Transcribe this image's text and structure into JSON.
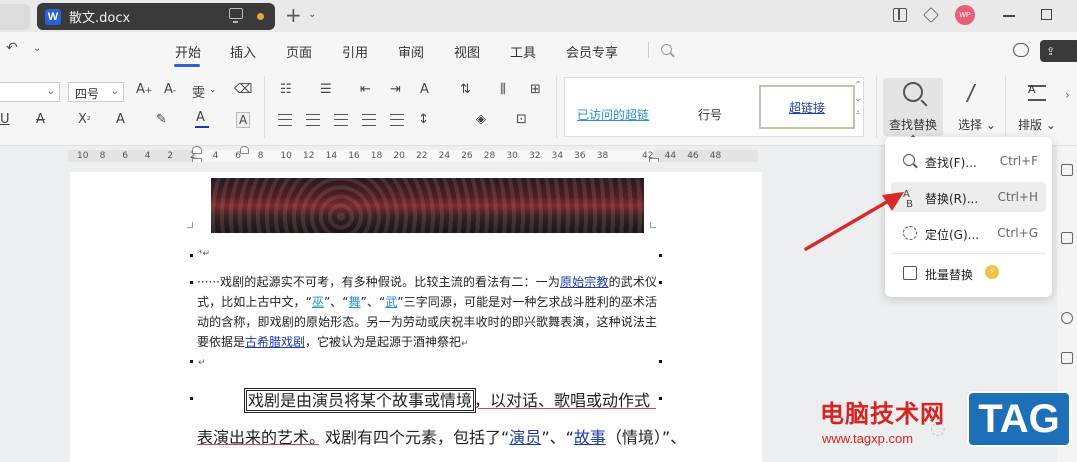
{
  "tabs": {
    "document_title": "散文.docx",
    "app_letter": "W",
    "new_tab_icon": "plus-icon",
    "avatar_text": "WP"
  },
  "menu": {
    "items": [
      "开始",
      "插入",
      "页面",
      "引用",
      "审阅",
      "视图",
      "工具",
      "会员专享"
    ],
    "active": "开始"
  },
  "ribbon": {
    "font_size": "四号",
    "styles": {
      "visited_link": "已访问的超链",
      "line_number": "行号",
      "hyperlink": "超链接"
    },
    "find_replace_label": "查找替换",
    "select_label": "选择",
    "layout_label": "排版"
  },
  "ruler": {
    "numbers": [
      "10",
      "8",
      "6",
      "4",
      "2",
      "2",
      "4",
      "6",
      "8",
      "10",
      "12",
      "14",
      "16",
      "18",
      "20",
      "22",
      "24",
      "26",
      "28",
      "30",
      "32",
      "34",
      "36",
      "38",
      "42",
      "44",
      "46",
      "48"
    ]
  },
  "document": {
    "para1": {
      "lead": "······戏剧的起源实不可考，有多种假说。比较主流的看法有二：一为",
      "link1": "原始宗教",
      "t1": "的武术仪式，比如上古中文，“",
      "link2": "巫",
      "t2": "”、“",
      "link3": "舞",
      "t3": "”、“",
      "link4": "武",
      "t4": "”三字同源，可能是对一种乞求战斗胜利的巫术活动的含称，即戏剧的原始形态。另一为劳动或庆祝丰收时的即兴歌舞表演，这种说法主要依据是",
      "link5": "古希腊戏剧",
      "t5": "，它被认为是起源于酒神祭祀"
    },
    "line1": {
      "boxed": "戏剧是由演员将某个故事或情境",
      "rest": "，以对话、歌唱或动作式"
    },
    "line2": {
      "t1": "表演出来的艺术。戏剧有四个元素，包括了“",
      "link1": "演员",
      "t2": "”、“",
      "link2": "故事",
      "t3": "（情境）”、"
    }
  },
  "dropdown": {
    "items": [
      {
        "label": "查找(F)...",
        "shortcut": "Ctrl+F",
        "icon": "search-icon"
      },
      {
        "label": "替换(R)...",
        "shortcut": "Ctrl+H",
        "icon": "replace-icon"
      },
      {
        "label": "定位(G)...",
        "shortcut": "Ctrl+G",
        "icon": "goto-icon"
      },
      {
        "label": "批量替换",
        "shortcut": "",
        "icon": "batch-replace-icon"
      }
    ]
  },
  "watermark": {
    "site_name": "电脑技术网",
    "url": "www.tagxp.com",
    "tag": "TAG"
  },
  "colors": {
    "accent": "#2b5fd6",
    "hyperlink": "#1e3aa8",
    "watermark_red": "#d62420",
    "tag_blue": "#1d6fb8",
    "arrow_red": "#d82a2a"
  }
}
